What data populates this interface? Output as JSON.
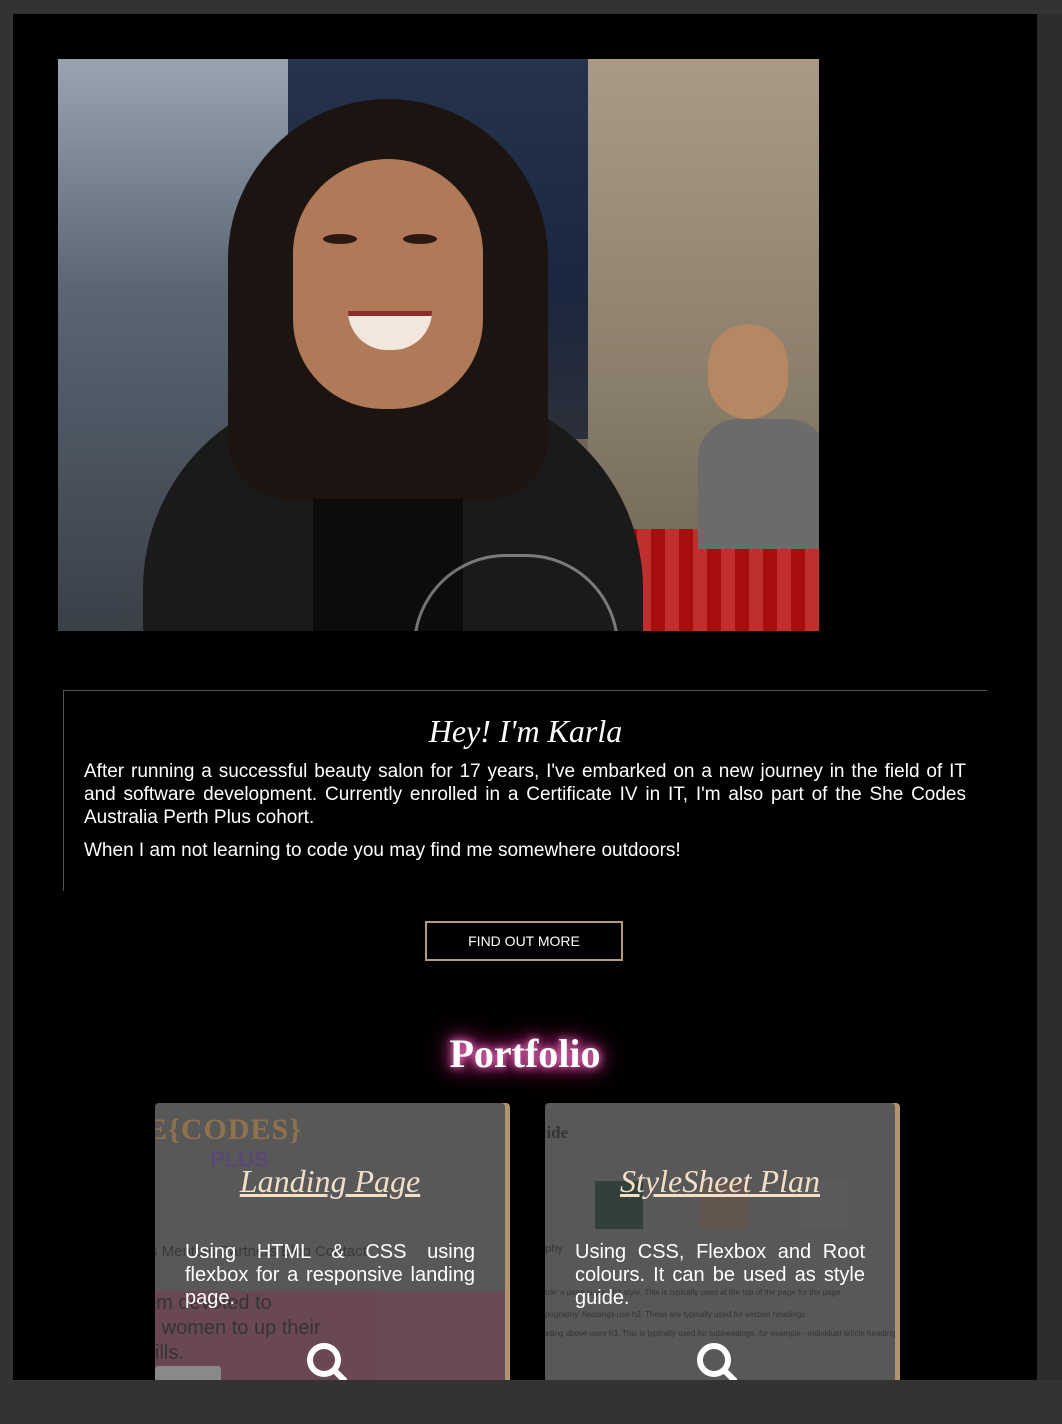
{
  "profile": {
    "photo_alt": ""
  },
  "about": {
    "title": "Hey! I'm Karla",
    "paragraph1": "After running a successful beauty salon for 17 years, I've embarked on a new journey in the field of IT and software development. Currently enrolled in a Certificate IV in IT, I'm also part of the She Codes Australia Perth Plus cohort.",
    "paragraph2": "When I am not learning to code you may find me somewhere outdoors!"
  },
  "cta": {
    "label": "FIND OUT MORE"
  },
  "portfolio": {
    "title": "Portfolio",
    "cards": [
      {
        "title": "Landing Page",
        "description": "Using HTML & CSS using flexbox for a responsive landing page.",
        "icon": "search-icon",
        "thumb": {
          "logo": "E{CODES}",
          "logo_sub": "PLUS",
          "nav": "rs    Mentors    Partners    Blog    Contact",
          "text_line1": "em           devoted to",
          "text_line2": "g women to up their",
          "text_line3": "kills."
        }
      },
      {
        "title": "StyleSheet Plan",
        "description": "Using CSS, Flexbox and Root colours. It can be used as style guide.",
        "icon": "search-icon",
        "thumb": {
          "heading": "uide",
          "label": "phy",
          "line1": "Guide' a                  page is your h1 style. This is typically used at the top of the page for the page",
          "line2": "'Typography' headings use h2. These are typically used for section headings.",
          "line3": "heading above uses h3. This is typically used for subheadings, for example - individual article heading"
        }
      }
    ]
  },
  "colors": {
    "page_background": "#000000",
    "chrome_background": "#333333",
    "button_border": "#b69a76",
    "glow": "#ff4fb8",
    "card_title": "#f3dfc8"
  }
}
